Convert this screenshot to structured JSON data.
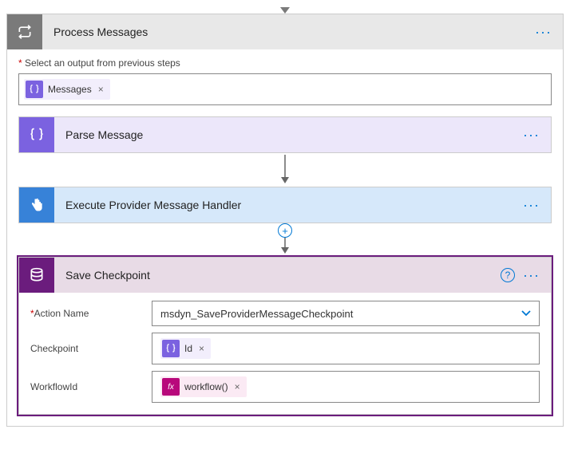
{
  "loop_card": {
    "title": "Process Messages",
    "output_label_prefix": "*",
    "output_label": "Select an output from previous steps",
    "token": {
      "label": "Messages",
      "close": "×"
    }
  },
  "parse_card": {
    "title": "Parse Message"
  },
  "exec_card": {
    "title": "Execute Provider Message Handler"
  },
  "save_card": {
    "title": "Save Checkpoint",
    "fields": {
      "action_label": "Action Name",
      "action_value": "msdyn_SaveProviderMessageCheckpoint",
      "checkpoint_label": "Checkpoint",
      "checkpoint_token": {
        "label": "Id",
        "close": "×"
      },
      "workflow_label": "WorkflowId",
      "workflow_token": {
        "label": "workflow()",
        "close": "×"
      }
    }
  },
  "glyph": {
    "more": "···",
    "help": "?",
    "add": "+",
    "token_x": "×",
    "fx": "fx"
  }
}
